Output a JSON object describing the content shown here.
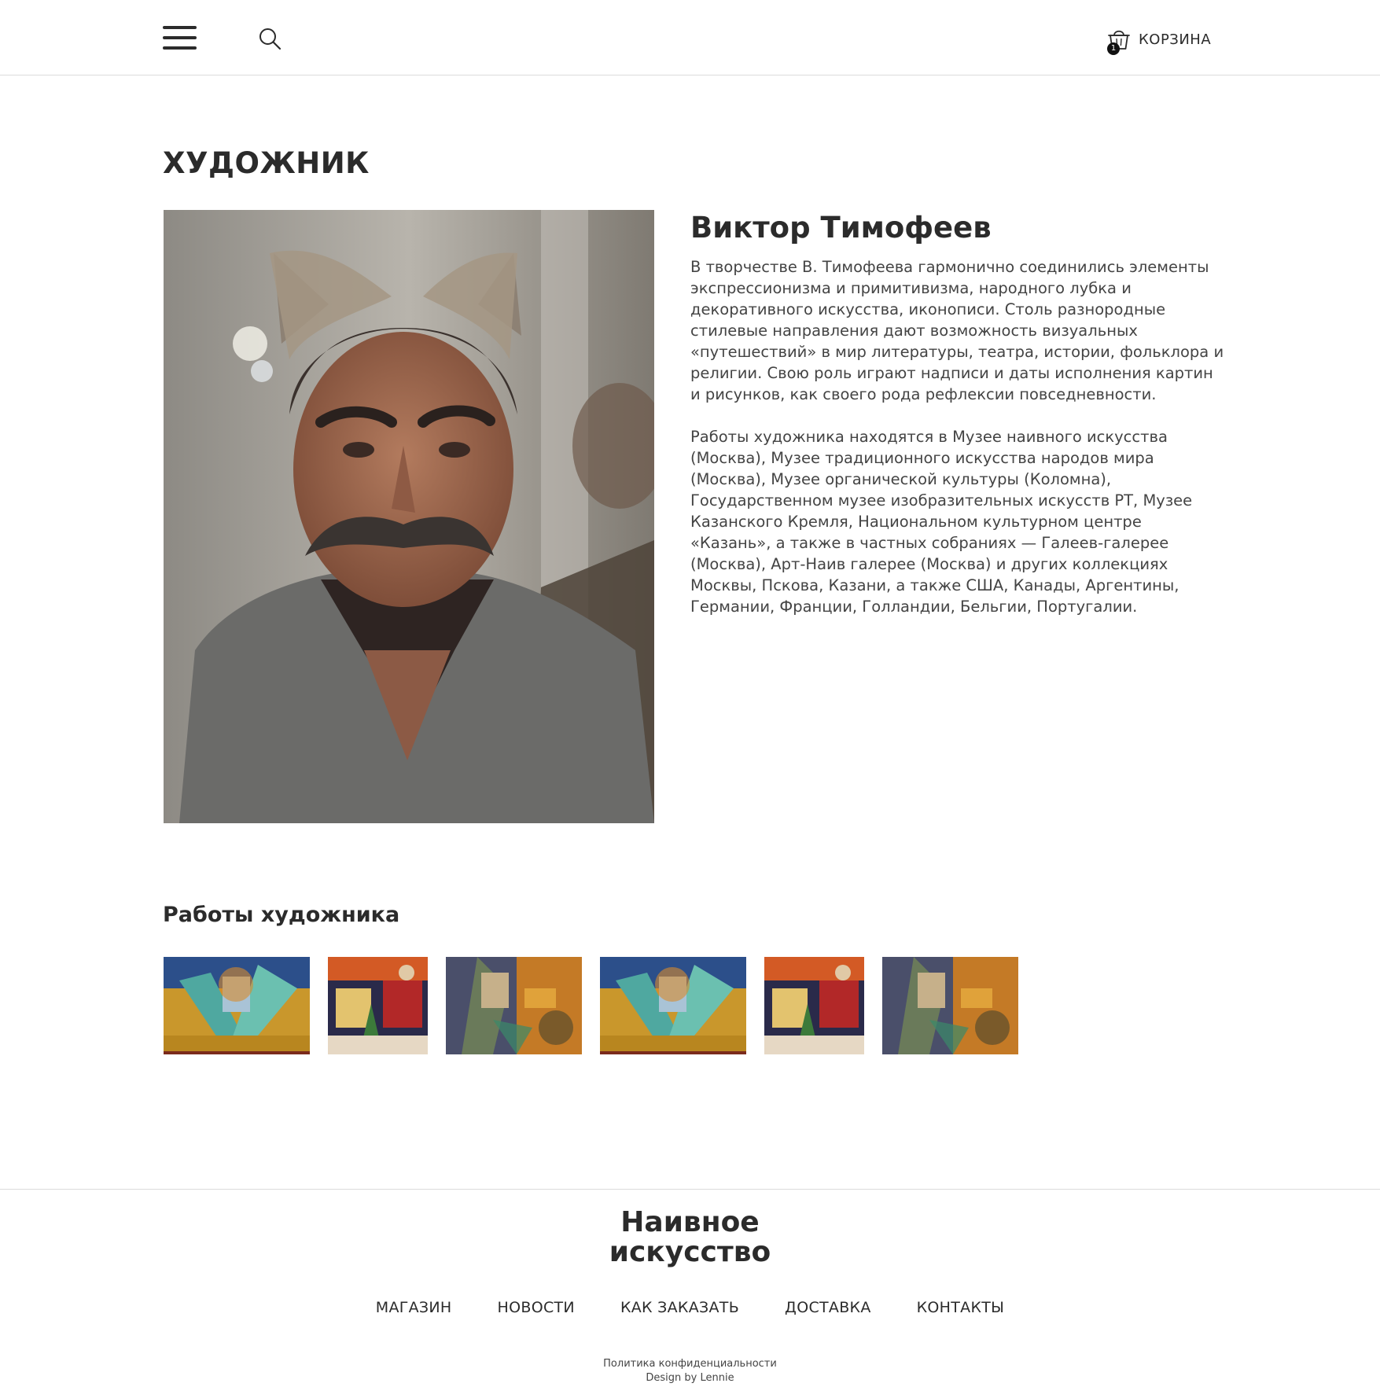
{
  "header": {
    "menu_icon": "hamburger-menu-icon",
    "search_icon": "search-icon",
    "cart": {
      "icon": "shopping-basket-icon",
      "count": "1",
      "label": "КОРЗИНА"
    }
  },
  "page": {
    "title": "ХУДОЖНИК"
  },
  "artist": {
    "name": "Виктор Тимофеев",
    "bio": [
      "В творчестве В. Тимофеева гармонично соединились элементы экспрессионизма и примитивизма, народного лубка и декоративного искусства, иконописи. Столь разнородные стилевые направления дают возможность визуальных «путешествий» в мир литературы, театра, истории, фольклора и религии. Свою роль играют надписи и даты исполнения картин и рисунков, как своего рода рефлексии повседневности.",
      "Работы художника находятся в Музее наивного искусства (Москва), Музее традиционного искусства народов мира (Москва), Музее органической культуры (Коломна), Государственном музее изобразительных искусств РТ, Музее Казанского Кремля, Национальном культурном центре «Казань», а также в частных собраниях — Галеев-галерее (Москва), Арт-Наив галерее (Москва) и других коллекциях Москвы, Пскова, Казани, а также США, Канады, Аргентины, Германии, Франции, Голландии, Бельгии, Португалии."
    ]
  },
  "works": {
    "title": "Работы художника"
  },
  "footer": {
    "logo_line1": "Наивное",
    "logo_line2": "искусство",
    "nav": [
      "МАГАЗИН",
      "НОВОСТИ",
      "КАК ЗАКАЗАТЬ",
      "ДОСТАВКА",
      "КОНТАКТЫ"
    ],
    "privacy": "Политика конфиденциальности",
    "credit": "Design by Lennie"
  }
}
